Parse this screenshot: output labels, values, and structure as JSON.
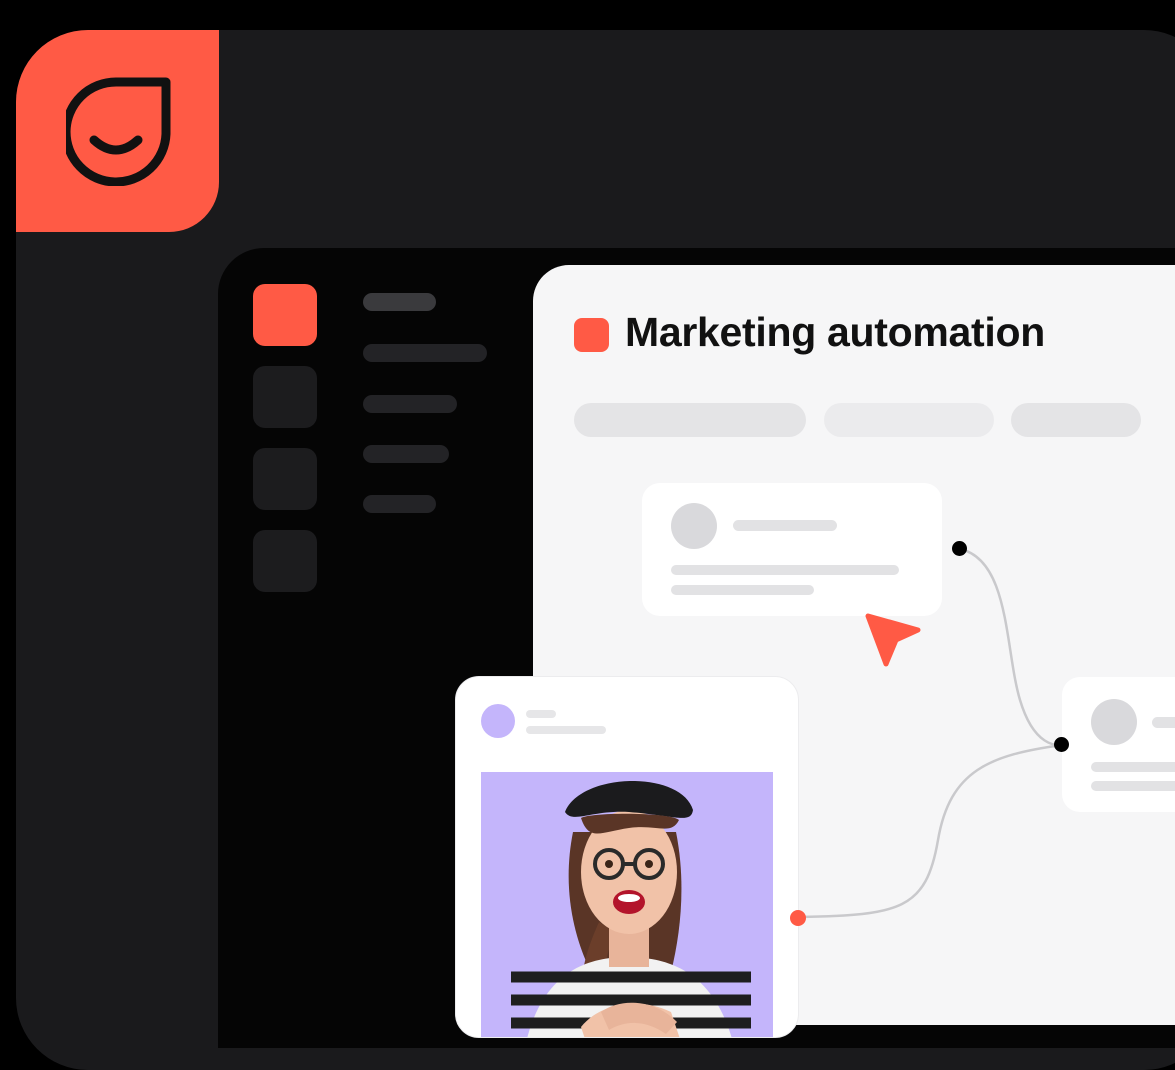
{
  "brand": {
    "accent_color": "#ff5a45",
    "logo_icon": "smile-drop-icon"
  },
  "sidebar": {
    "items": [
      {
        "icon": "active-nav-square",
        "active": true
      },
      {
        "icon": "nav-square",
        "active": false
      },
      {
        "icon": "nav-square",
        "active": false
      },
      {
        "icon": "nav-square",
        "active": false
      }
    ]
  },
  "workspace": {
    "title": "Marketing automation",
    "title_badge_icon": "red-square-icon",
    "cursor_icon": "pointer-arrow-icon"
  },
  "post_card": {
    "photo_background": "#c4b5fb",
    "photo_subject": "excited-woman-photo"
  }
}
